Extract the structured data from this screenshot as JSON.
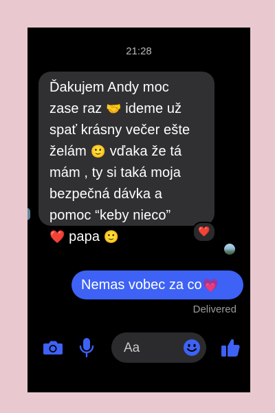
{
  "status": {
    "time": "21:28"
  },
  "thread": {
    "incoming_message": {
      "text_parts": [
        "Ďakujem Andy moc\nzase raz ",
        "🤝",
        " ideme už\nspať krásny večer ešte\nželám ",
        "🙂",
        " vďaka že tá\nmám , ty si taká moja\nbezpečná dávka a\npomoc “keby nieco”\n",
        "❤️",
        " papa ",
        "🙂"
      ],
      "reaction": "❤️"
    },
    "outgoing_message": {
      "text": "Nemas vobec za co",
      "emoji": "💗",
      "status": "Delivered"
    }
  },
  "composer": {
    "placeholder": "Aa",
    "icons": [
      "camera-icon",
      "microphone-icon",
      "emoji-icon",
      "thumbs-up-icon"
    ]
  },
  "colors": {
    "accent": "#3d62f5",
    "incoming_bubble": "#303033",
    "background": "#000000",
    "frame": "#e9c9cf"
  }
}
